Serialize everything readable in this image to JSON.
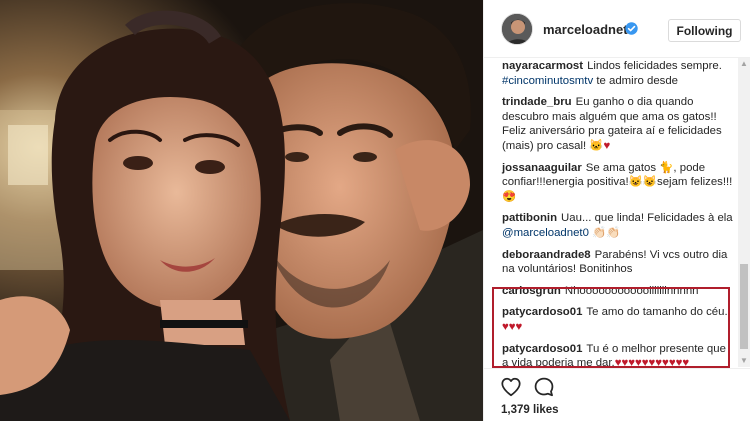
{
  "post": {
    "username": "marceloadnet0",
    "follow_label": "Following",
    "likes": "1,379 likes"
  },
  "comments": [
    {
      "author": "nayaracarmost",
      "parts": [
        {
          "type": "text",
          "value": "Lindos felicidades sempre. "
        },
        {
          "type": "tag",
          "value": "#cincominutosmtv"
        },
        {
          "type": "text",
          "value": " te admiro desde"
        }
      ]
    },
    {
      "author": "trindade_bru",
      "parts": [
        {
          "type": "text",
          "value": "Eu ganho o dia quando descubro mais alguém que ama os gatos!! Feliz aniversário pra gateira aí e felicidades (mais) pro casal! "
        },
        {
          "type": "emoji-gray",
          "value": "🐱"
        },
        {
          "type": "emoji",
          "value": "♥"
        }
      ]
    },
    {
      "author": "jossanaaguilar",
      "parts": [
        {
          "type": "text",
          "value": "Se ama gatos "
        },
        {
          "type": "emoji-gray",
          "value": "🐈"
        },
        {
          "type": "text",
          "value": ", pode confiar!!!energia positiva!"
        },
        {
          "type": "emoji-gray",
          "value": "😺😺"
        },
        {
          "type": "text",
          "value": "sejam felizes!!!"
        },
        {
          "type": "emoji-gray",
          "value": "😍"
        }
      ]
    },
    {
      "author": "pattibonin",
      "parts": [
        {
          "type": "text",
          "value": "Uau... que linda! Felicidades à ela "
        },
        {
          "type": "mention",
          "value": "@marceloadnet0"
        },
        {
          "type": "text",
          "value": " "
        },
        {
          "type": "emoji-gray",
          "value": "👏🏻👏🏻"
        }
      ]
    },
    {
      "author": "deboraandrade8",
      "parts": [
        {
          "type": "text",
          "value": "Parabéns! Vi vcs outro dia na voluntários! Bonitinhos"
        }
      ]
    },
    {
      "author": "carlosgrun",
      "parts": [
        {
          "type": "text",
          "value": "Nhoooooooooooiiiiiiinnnnn"
        }
      ]
    },
    {
      "author": "patycardoso01",
      "parts": [
        {
          "type": "text",
          "value": "Te amo do tamanho do céu. "
        },
        {
          "type": "emoji",
          "value": "♥♥♥"
        }
      ]
    },
    {
      "author": "patycardoso01",
      "parts": [
        {
          "type": "text",
          "value": "Tu é o melhor presente que a vida poderia me dar."
        },
        {
          "type": "emoji",
          "value": "♥♥♥♥♥♥♥♥♥♥♥"
        }
      ]
    }
  ],
  "colors": {
    "highlight_border": "#b01e2c",
    "link": "#003569",
    "heart": "#c0192b"
  },
  "icons": {
    "verified": "verified-badge-icon",
    "like": "heart-outline-icon",
    "comment": "comment-bubble-icon"
  }
}
